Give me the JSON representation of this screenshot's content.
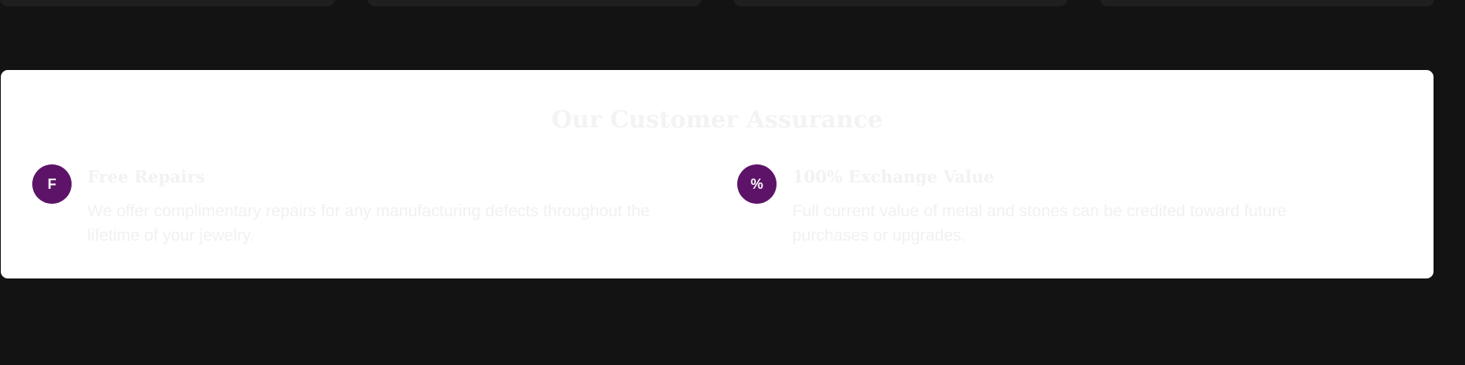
{
  "assurance": {
    "title": "Our Customer Assurance",
    "features": [
      {
        "badge": "F",
        "heading": "Free Repairs",
        "description": "We offer complimentary repairs for any manufacturing defects throughout the lifetime of your jewelry."
      },
      {
        "badge": "%",
        "heading": "100% Exchange Value",
        "description": "Full current value of metal and stones can be credited toward future purchases or upgrades."
      }
    ]
  },
  "colors": {
    "page_background": "#131313",
    "card_background": "#1f1f1f",
    "panel_background": "#ffffff",
    "badge_background": "#5d1468",
    "badge_text": "#ffffff",
    "faded_text": "#f2f2f2"
  }
}
